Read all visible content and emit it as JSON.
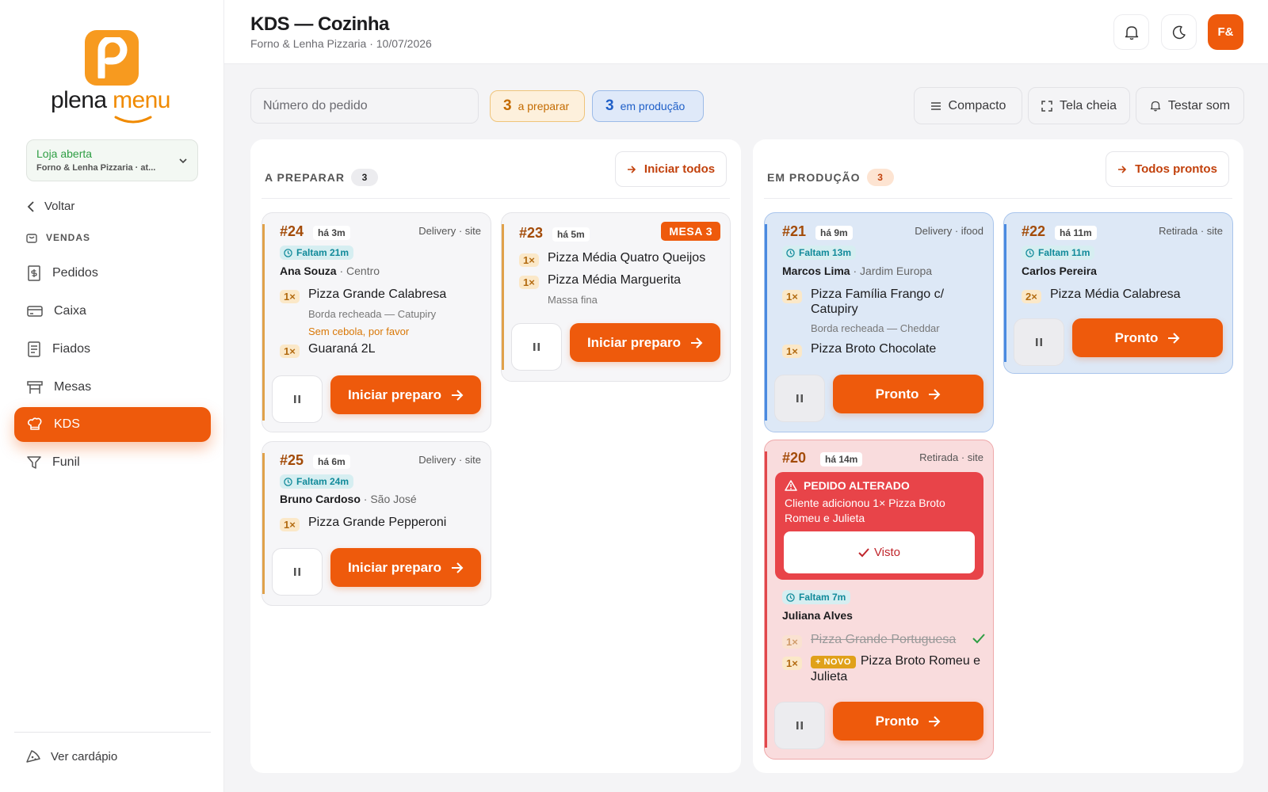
{
  "brand": {
    "name_a": "plena",
    "name_b": "menu"
  },
  "sidebar": {
    "store": {
      "status": "Loja aberta",
      "name": "Forno & Lenha Pizzaria · at..."
    },
    "back": "Voltar",
    "section": "VENDAS",
    "items": [
      {
        "label": "Pedidos",
        "icon": "receipt-icon"
      },
      {
        "label": "Caixa",
        "icon": "card-icon"
      },
      {
        "label": "Fiados",
        "icon": "notebook-icon"
      },
      {
        "label": "Mesas",
        "icon": "table-icon"
      },
      {
        "label": "KDS",
        "icon": "chef-hat-icon",
        "active": true
      },
      {
        "label": "Funil",
        "icon": "funnel-icon"
      }
    ],
    "see_menu": "Ver cardápio"
  },
  "header": {
    "title": "KDS — Cozinha",
    "subtitle": "Forno & Lenha Pizzaria · 10/07/2026",
    "avatar": "F&"
  },
  "toolbar": {
    "search_placeholder": "Número do pedido",
    "prep_count": "3",
    "prep_label": "a preparar",
    "prod_count": "3",
    "prod_label": "em produção",
    "compact": "Compacto",
    "fullscreen": "Tela cheia",
    "test_sound": "Testar som"
  },
  "columns": [
    {
      "title": "A PREPARAR",
      "count": "3",
      "action": "Iniciar todos"
    },
    {
      "title": "EM PRODUÇÃO",
      "count": "3",
      "action": "Todos prontos"
    }
  ],
  "orders": {
    "o24": {
      "num": "#24",
      "ago": "há 3m",
      "source": "Delivery · site",
      "timer": "Faltam 21m",
      "customer": "Ana Souza",
      "area": " · Centro",
      "items": [
        {
          "qty": "1×",
          "name": "Pizza Grande Calabresa",
          "note": "Borda recheada — Catupiry",
          "warn": "Sem cebola, por favor"
        },
        {
          "qty": "1×",
          "name": "Guaraná 2L"
        }
      ],
      "action": "Iniciar preparo"
    },
    "o25": {
      "num": "#25",
      "ago": "há 6m",
      "source": "Delivery · site",
      "timer": "Faltam 24m",
      "customer": "Bruno Cardoso",
      "area": " · São José",
      "items": [
        {
          "qty": "1×",
          "name": "Pizza Grande Pepperoni"
        }
      ],
      "action": "Iniciar preparo"
    },
    "o23": {
      "num": "#23",
      "ago": "há 5m",
      "badge": "MESA 3",
      "items": [
        {
          "qty": "1×",
          "name": "Pizza Média Quatro Queijos"
        },
        {
          "qty": "1×",
          "name": "Pizza Média Marguerita",
          "note": "Massa fina"
        }
      ],
      "action": "Iniciar preparo"
    },
    "o21": {
      "num": "#21",
      "ago": "há 9m",
      "source": "Delivery · ifood",
      "timer": "Faltam 13m",
      "customer": "Marcos Lima",
      "area": " · Jardim Europa",
      "items": [
        {
          "qty": "1×",
          "name_l1": "Pizza Família Frango c/",
          "name_l2": "Catupiry",
          "note": "Borda recheada — Cheddar"
        },
        {
          "qty": "1×",
          "name": "Pizza Broto Chocolate"
        }
      ],
      "action": "Pronto"
    },
    "o22": {
      "num": "#22",
      "ago": "há 11m",
      "source": "Retirada · site",
      "timer": "Faltam 11m",
      "customer": "Carlos Pereira",
      "items": [
        {
          "qty": "2×",
          "name": "Pizza Média Calabresa"
        }
      ],
      "action": "Pronto"
    },
    "o20": {
      "num": "#20",
      "ago": "há 14m",
      "source": "Retirada · site",
      "alert": {
        "title": "PEDIDO ALTERADO",
        "desc": "Cliente adicionou 1× Pizza Broto Romeu e Julieta",
        "seen": "Visto"
      },
      "timer": "Faltam 7m",
      "customer": "Juliana Alves",
      "items": [
        {
          "qty": "1×",
          "name": "Pizza Grande Portuguesa",
          "removed": true
        },
        {
          "qty": "1×",
          "badge": "+ NOVO",
          "name_l1": "Pizza Broto Romeu e",
          "name_l2": "Julieta"
        }
      ],
      "action": "Pronto"
    }
  },
  "colors": {
    "accent": "#ee5a0c",
    "prep_bar": "#e0a14a",
    "prod_bar": "#4a8ae0",
    "alert": "#e84449"
  }
}
